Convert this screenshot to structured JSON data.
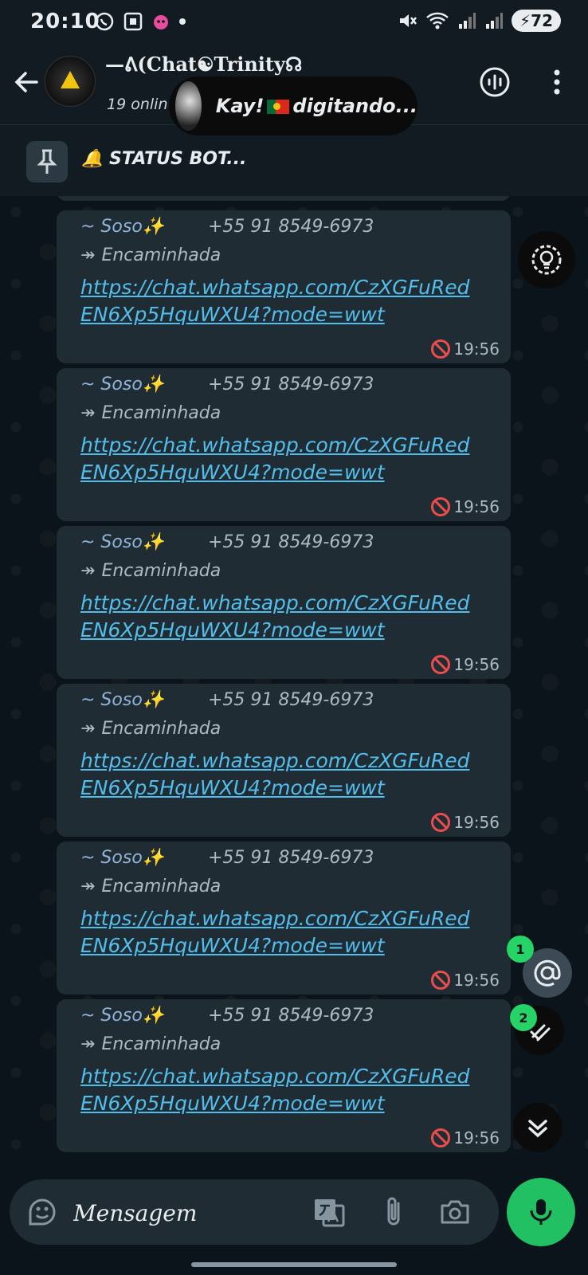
{
  "status_bar": {
    "time": "20:10",
    "battery": "72",
    "left_icons": [
      "whatsapp-icon",
      "screenshot-icon",
      "notification-icon"
    ],
    "right_icons": [
      "mute-icon",
      "wifi-icon",
      "signal-icon",
      "signal-icon"
    ]
  },
  "header": {
    "group_name": "—ᕕ(Chat☯Trinity☊",
    "online": "19 onlin",
    "typing_name": "Kay!",
    "typing_suffix": "digitando..."
  },
  "pinned": {
    "text": "🔔 STATUS BOT..."
  },
  "messages": [
    {
      "sender": "~ Soso✨",
      "phone": "+55 91 8549-6973",
      "forwarded": "Encaminhada",
      "link": "https://chat.whatsapp.com/CzXGFuRedEN6Xp5HquWXU4?mode=wwt",
      "time": "19:56"
    },
    {
      "sender": "~ Soso✨",
      "phone": "+55 91 8549-6973",
      "forwarded": "Encaminhada",
      "link": "https://chat.whatsapp.com/CzXGFuRedEN6Xp5HquWXU4?mode=wwt",
      "time": "19:56"
    },
    {
      "sender": "~ Soso✨",
      "phone": "+55 91 8549-6973",
      "forwarded": "Encaminhada",
      "link": "https://chat.whatsapp.com/CzXGFuRedEN6Xp5HquWXU4?mode=wwt",
      "time": "19:56"
    },
    {
      "sender": "~ Soso✨",
      "phone": "+55 91 8549-6973",
      "forwarded": "Encaminhada",
      "link": "https://chat.whatsapp.com/CzXGFuRedEN6Xp5HquWXU4?mode=wwt",
      "time": "19:56"
    },
    {
      "sender": "~ Soso✨",
      "phone": "+55 91 8549-6973",
      "forwarded": "Encaminhada",
      "link": "https://chat.whatsapp.com/CzXGFuRedEN6Xp5HquWXU4?mode=wwt",
      "time": "19:56"
    },
    {
      "sender": "~ Soso✨",
      "phone": "+55 91 8549-6973",
      "forwarded": "Encaminhada",
      "link": "https://chat.whatsapp.com/CzXGFuRedEN6Xp5HquWXU4?mode=wwt",
      "time": "19:56"
    }
  ],
  "badges": {
    "mentions": "1",
    "reactions": "2"
  },
  "input": {
    "placeholder": "Mensagem"
  },
  "colors": {
    "background": "#0b141a",
    "bubble": "#202c33",
    "link": "#53bdeb",
    "accent": "#21c063",
    "deleted": "#ea4d4d"
  }
}
